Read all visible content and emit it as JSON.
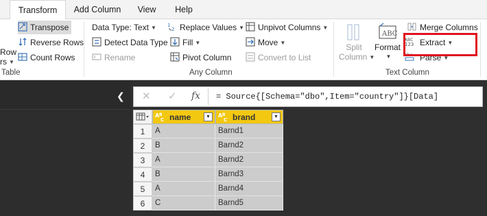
{
  "tabs": [
    {
      "label": "Transform",
      "active": true
    },
    {
      "label": "Add Column"
    },
    {
      "label": "View"
    },
    {
      "label": "Help"
    }
  ],
  "ribbon": {
    "table_group": {
      "label": "Table",
      "partial_row": "Row",
      "partial_rs": "rs",
      "transpose": "Transpose",
      "reverse_rows": "Reverse Rows",
      "count_rows": "Count Rows"
    },
    "any_column_group": {
      "label": "Any Column",
      "data_type": "Data Type: Text",
      "detect_data_type": "Detect Data Type",
      "rename": "Rename",
      "replace_values": "Replace Values",
      "fill": "Fill",
      "pivot_column": "Pivot Column",
      "unpivot_columns": "Unpivot Columns",
      "move": "Move",
      "convert_to_list": "Convert to List"
    },
    "text_column_group": {
      "label": "Text Column",
      "split_column_line1": "Split",
      "split_column_line2": "Column",
      "format": "Format",
      "merge_columns": "Merge Columns",
      "extract": "Extract",
      "parse": "Parse"
    }
  },
  "formula_bar": {
    "cancel_glyph": "✕",
    "commit_glyph": "✓",
    "fx": "fx",
    "formula": "= Source{[Schema=\"dbo\",Item=\"country\"]}[Data]"
  },
  "grid": {
    "columns": [
      {
        "name": "name",
        "type_icon": "ABC"
      },
      {
        "name": "brand",
        "type_icon": "ABC"
      }
    ],
    "rows": [
      {
        "num": "1",
        "name": "A",
        "brand": "Barnd1"
      },
      {
        "num": "2",
        "name": "B",
        "brand": "Barnd2"
      },
      {
        "num": "3",
        "name": "A",
        "brand": "Barnd2"
      },
      {
        "num": "4",
        "name": "B",
        "brand": "Barnd3"
      },
      {
        "num": "5",
        "name": "A",
        "brand": "Barnd4"
      },
      {
        "num": "6",
        "name": "C",
        "brand": "Barnd5"
      }
    ]
  },
  "colors": {
    "accent_highlight": "#e0131f",
    "column_header": "#f2c811",
    "dark_pane": "#2f2f2f"
  }
}
